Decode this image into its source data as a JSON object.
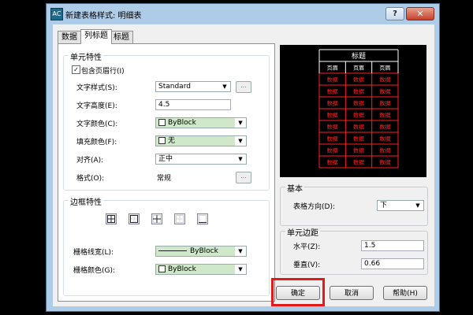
{
  "window": {
    "app_icon": "AC",
    "title": "新建表格样式: 明细表",
    "help_label": "?",
    "close_label": "✕"
  },
  "tabs": [
    {
      "label": "数据",
      "active": false
    },
    {
      "label": "列标题",
      "active": true
    },
    {
      "label": "标题",
      "active": false
    }
  ],
  "cell_props": {
    "group_title": "单元特性",
    "include_header_checkbox": {
      "label": "包含页眉行(I)",
      "checked": true
    },
    "text_style": {
      "label": "文字样式(S):",
      "value": "Standard"
    },
    "text_height": {
      "label": "文字高度(E):",
      "value": "4.5"
    },
    "text_color": {
      "label": "文字颜色(C):",
      "value": "ByBlock"
    },
    "fill_color": {
      "label": "填充颜色(F):",
      "value": "无"
    },
    "alignment": {
      "label": "对齐(A):",
      "value": "正中"
    },
    "format": {
      "label": "格式(O):",
      "value": "常规"
    }
  },
  "border_props": {
    "group_title": "边框特性",
    "border_buttons": [
      "all-borders-icon",
      "outer-border-icon",
      "inner-border-icon",
      "no-border-icon",
      "bottom-border-icon"
    ],
    "grid_lineweight": {
      "label": "栅格线宽(L):",
      "value": "ByBlock"
    },
    "grid_color": {
      "label": "栅格颜色(G):",
      "value": "ByBlock"
    }
  },
  "preview": {
    "title": "标题",
    "header": "页眉",
    "data": "数据",
    "line_color": "#ff2020",
    "title_color": "#ffffff"
  },
  "basic": {
    "group_title": "基本",
    "table_direction": {
      "label": "表格方向(D):",
      "value": "下"
    }
  },
  "cell_margins": {
    "group_title": "单元边距",
    "horizontal": {
      "label": "水平(Z):",
      "value": "1.5"
    },
    "vertical": {
      "label": "垂直(V):",
      "value": "0.66"
    }
  },
  "buttons": {
    "ok": "确定",
    "cancel": "取消",
    "help": "帮助(H)"
  },
  "colors": {
    "highlight": "#e31b1b",
    "green_combo": "#cfe8c9"
  }
}
